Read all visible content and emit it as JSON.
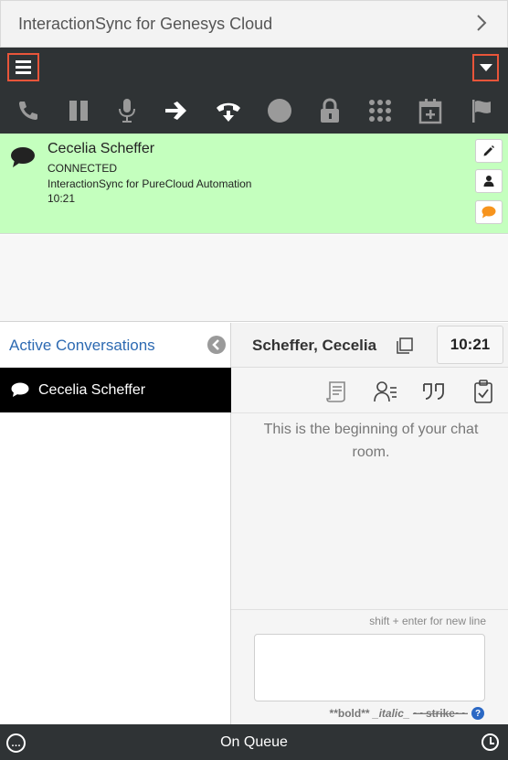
{
  "app": {
    "title": "InteractionSync for Genesys Cloud"
  },
  "toolbar": {
    "icons": [
      "phone-icon",
      "hold-icon",
      "microphone-icon",
      "transfer-icon",
      "disconnect-icon",
      "record-icon",
      "secure-pause-icon",
      "dialpad-icon",
      "schedule-icon",
      "flag-icon"
    ]
  },
  "interaction": {
    "name": "Cecelia Scheffer",
    "state": "CONNECTED",
    "queue": "InteractionSync for PureCloud Automation",
    "duration": "10:21",
    "background_color": "#c4ffbe"
  },
  "active_conversations": {
    "title": "Active Conversations",
    "items": [
      {
        "name": "Cecelia Scheffer",
        "icon": "chat-bubble-icon"
      }
    ]
  },
  "chat": {
    "header_name": "Scheffer, Cecelia",
    "timer": "10:21",
    "beginning_message": "This is the beginning of your chat room.",
    "shift_hint": "shift + enter for new line",
    "input_value": "",
    "format_hint": {
      "bold": "**bold**",
      "italic": "_italic_",
      "strike": "~~strike~~"
    },
    "help_label": "?"
  },
  "status_bar": {
    "status": "On Queue"
  },
  "colors": {
    "accent": "#e8553a",
    "dark_bar": "#2f3335",
    "link_blue": "#2d6ab2",
    "orange_chat": "#f7941d"
  }
}
